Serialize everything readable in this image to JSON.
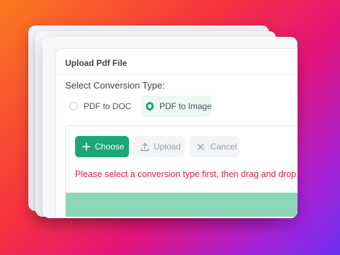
{
  "panel": {
    "title": "Upload Pdf File",
    "select_label": "Select Conversion Type:"
  },
  "conversion_options": [
    {
      "label": "PDF to DOC",
      "selected": false
    },
    {
      "label": "PDF to Image",
      "selected": true
    }
  ],
  "toolbar": {
    "choose_label": "Choose",
    "upload_label": "Upload",
    "cancel_label": "Cancel"
  },
  "message": "Please select a conversion type first, then drag and drop",
  "colors": {
    "accent": "#19a873",
    "error": "#e0203a",
    "progress_bar": "#8dd6b8"
  },
  "icons": {
    "choose": "plus-icon",
    "upload": "upload-icon",
    "cancel": "close-icon"
  }
}
